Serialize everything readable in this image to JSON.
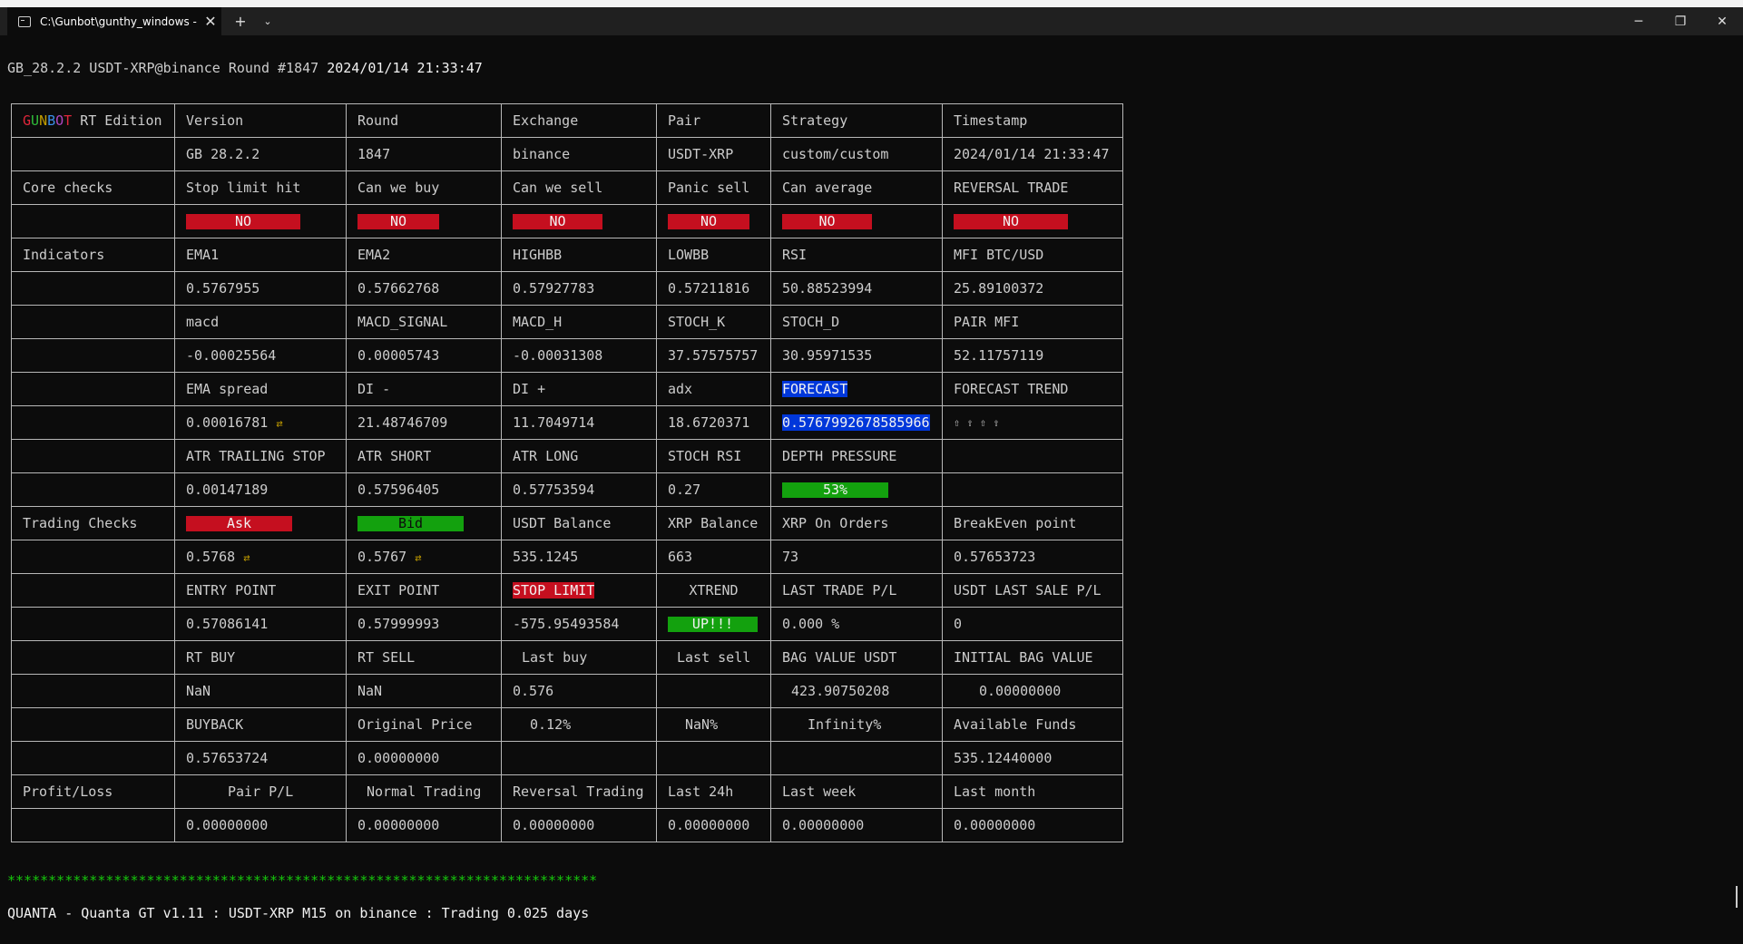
{
  "window": {
    "tab_title": "C:\\Gunbot\\gunthy_windows -",
    "new_tab": "+",
    "dropdown": "⌄",
    "close_tab": "✕",
    "minimize": "─",
    "maximize": "❐",
    "close": "✕"
  },
  "header_line": {
    "prefix": "GB_28.2.2 USDT-XRP@binance Round #1847 ",
    "datetime": "2024/01/14 21:33:47"
  },
  "logo": {
    "letters": [
      "G",
      "U",
      "N",
      "B",
      "O",
      "T"
    ],
    "colors": [
      "#e0263a",
      "#2fbf3a",
      "#c19c00",
      "#3b8eea",
      "#b146c2",
      "#e0263a"
    ],
    "suffix": " RT Edition"
  },
  "info": {
    "headers": [
      "Version",
      "Round",
      "Exchange",
      "Pair",
      "Strategy",
      "Timestamp"
    ],
    "values": [
      "GB 28.2.2",
      "1847",
      "binance",
      "USDT-XRP",
      "custom/custom",
      "2024/01/14 21:33:47"
    ]
  },
  "core": {
    "label": "Core checks",
    "headers": [
      "Stop limit hit",
      "Can we buy",
      "Can we sell",
      "Panic sell",
      "Can average",
      "REVERSAL TRADE"
    ],
    "values": [
      "NO",
      "NO",
      "NO",
      "NO",
      "NO",
      "NO"
    ]
  },
  "indicators": {
    "label": "Indicators",
    "r1h": [
      "EMA1",
      "EMA2",
      "HIGHBB",
      "LOWBB",
      "RSI",
      "MFI BTC/USD"
    ],
    "r1v": [
      "0.5767955",
      "0.57662768",
      "0.57927783",
      "0.57211816",
      "50.88523994",
      "25.89100372"
    ],
    "r2h": [
      "macd",
      "MACD_SIGNAL",
      "MACD_H",
      "STOCH_K",
      "STOCH_D",
      "PAIR MFI"
    ],
    "r2v": [
      "-0.00025564",
      "0.00005743",
      "-0.00031308",
      "37.57575757",
      "30.95971535",
      "52.11757119"
    ],
    "r3h": [
      "EMA spread",
      "DI -",
      "DI +",
      "adx",
      "FORECAST",
      "FORECAST TREND"
    ],
    "r3v": [
      "0.00016781",
      "21.48746709",
      "11.7049714",
      "18.6720371",
      "0.5767992678585966",
      "⇧ ⇧ ⇧ ⇧"
    ],
    "arrow": "⇄",
    "r4h": [
      "ATR TRAILING STOP",
      "ATR SHORT",
      "ATR LONG",
      "STOCH RSI",
      "DEPTH PRESSURE",
      ""
    ],
    "r4v": [
      "0.00147189",
      "0.57596405",
      "0.57753594",
      "0.27",
      "53%",
      ""
    ]
  },
  "trading": {
    "label": "Trading Checks",
    "r1h": [
      "Ask",
      "Bid",
      "USDT Balance",
      "XRP Balance",
      "XRP On Orders",
      "BreakEven point"
    ],
    "r1v": [
      "0.5768",
      "0.5767",
      "535.1245",
      "663",
      "73",
      "0.57653723"
    ],
    "r2h": [
      "ENTRY POINT",
      "EXIT POINT",
      "STOP LIMIT",
      "XTREND",
      "LAST TRADE P/L",
      "USDT LAST SALE P/L"
    ],
    "r2v": [
      "0.57086141",
      "0.57999993",
      "-575.95493584",
      "UP!!!",
      "0.000 %",
      "0"
    ],
    "r3h": [
      "RT BUY",
      "RT SELL",
      "Last buy",
      "Last sell",
      "BAG VALUE USDT",
      "INITIAL BAG VALUE"
    ],
    "r3v": [
      "NaN",
      "NaN",
      "0.576",
      "",
      "423.90750208",
      "0.00000000"
    ],
    "r4h": [
      "BUYBACK",
      "Original Price",
      "0.12%",
      "NaN%",
      "Infinity%",
      "Available Funds"
    ],
    "r4v": [
      "0.57653724",
      "0.00000000",
      "",
      "",
      "",
      "535.12440000"
    ]
  },
  "pl": {
    "label": "Profit/Loss",
    "headers": [
      "Pair P/L",
      "Normal Trading",
      "Reversal Trading",
      "Last 24h",
      "Last week",
      "Last month"
    ],
    "values": [
      "0.00000000",
      "0.00000000",
      "0.00000000",
      "0.00000000",
      "0.00000000",
      "0.00000000"
    ]
  },
  "footer": {
    "stars": "************************************************************************",
    "quanta": "QUANTA - Quanta GT v1.11 : USDT-XRP M15 on binance : Trading 0.025 days"
  }
}
